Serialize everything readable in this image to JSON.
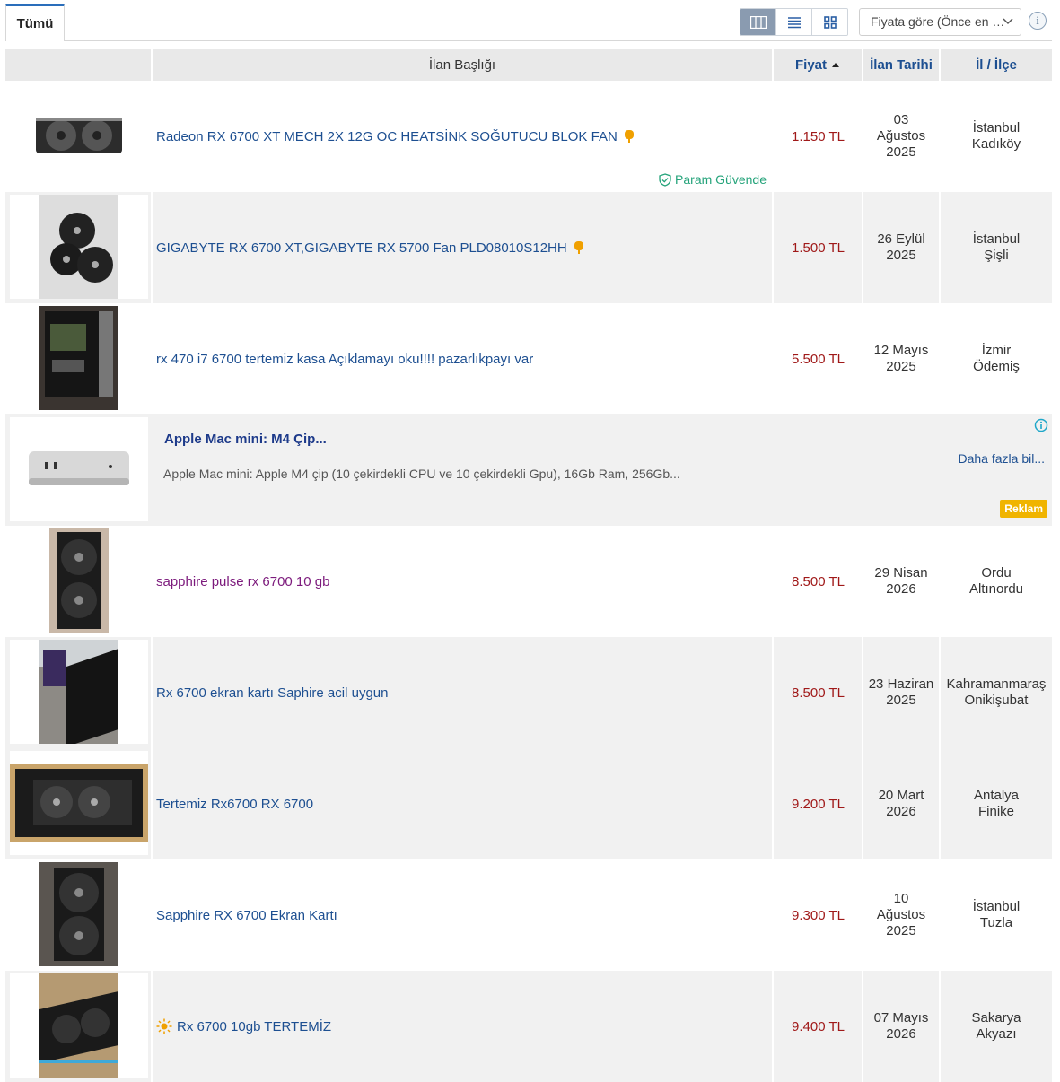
{
  "tabs": {
    "all_label": "Tümü"
  },
  "toolbar": {
    "sort_label": "Fiyata göre (Önce en …",
    "views": [
      "gallery-list-view",
      "list-view",
      "grid-view"
    ],
    "active_view": "gallery-list-view"
  },
  "table": {
    "headers": {
      "title": "İlan Başlığı",
      "price": "Fiyat",
      "date": "İlan Tarihi",
      "location": "İl / İlçe"
    }
  },
  "listings": [
    {
      "title": "Radeon RX 6700 XT MECH 2X 12G OC HEATSİNK SOĞUTUCU BLOK FAN",
      "price": "1.150 TL",
      "date_1": "03",
      "date_2": "Ağustos",
      "date_3": "2025",
      "city": "İstanbul",
      "district": "Kadıköy",
      "secure_label": "Param Güvende",
      "badge": "pin-icon"
    },
    {
      "title": "GIGABYTE RX 6700 XT,GIGABYTE RX 5700 Fan PLD08010S12HH",
      "price": "1.500 TL",
      "date_1": "26 Eylül",
      "date_2": "2025",
      "city": "İstanbul",
      "district": "Şişli",
      "badge": "pin-icon"
    },
    {
      "title": "rx 470 i7 6700 tertemiz kasa Açıklamayı oku!!!! pazarlıkpayı var",
      "price": "5.500 TL",
      "date_1": "12 Mayıs",
      "date_2": "2025",
      "city": "İzmir",
      "district": "Ödemiş"
    },
    {
      "title": "sapphire pulse rx 6700 10 gb",
      "price": "8.500 TL",
      "date_1": "29 Nisan",
      "date_2": "2026",
      "city": "Ordu",
      "district": "Altınordu",
      "visited": true
    },
    {
      "title": "Rx 6700 ekran kartı Saphire acil uygun",
      "price": "8.500 TL",
      "date_1": "23 Haziran",
      "date_2": "2025",
      "city": "Kahramanmaraş",
      "district": "Onikişubat"
    },
    {
      "title": "Tertemiz Rx6700 RX 6700",
      "price": "9.200 TL",
      "date_1": "20 Mart",
      "date_2": "2026",
      "city": "Antalya",
      "district": "Finike"
    },
    {
      "title": "Sapphire RX 6700 Ekran Kartı",
      "price": "9.300 TL",
      "date_1": "10",
      "date_2": "Ağustos",
      "date_3": "2025",
      "city": "İstanbul",
      "district": "Tuzla"
    },
    {
      "title": "Rx 6700 10gb TERTEMİZ",
      "price": "9.400 TL",
      "date_1": "07 Mayıs",
      "date_2": "2026",
      "city": "Sakarya",
      "district": "Akyazı",
      "badge": "sun-icon"
    }
  ],
  "ad": {
    "title": "Apple Mac mini: M4 Çip...",
    "description": "Apple Mac mini: Apple M4 çip (10 çekirdekli CPU ve 10 çekirdekli Gpu), 16Gb Ram, 256Gb...",
    "more_label": "Daha fazla bil...",
    "badge_label": "Reklam"
  },
  "colors": {
    "link": "#1d4f91",
    "price": "#a01919",
    "secure": "#24a37a",
    "ad_badge": "#f0b400"
  }
}
